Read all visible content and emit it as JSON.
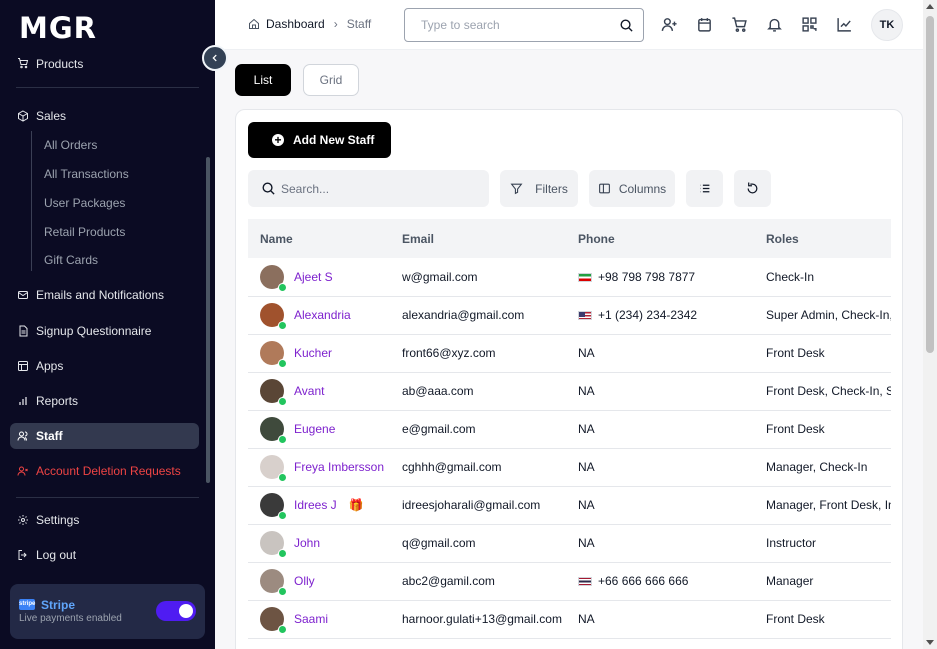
{
  "app": {
    "logo": "MGR"
  },
  "sidebar": {
    "items": [
      {
        "label": "Products",
        "icon": "cart-icon"
      },
      {
        "label": "Sales",
        "icon": "box-icon"
      },
      {
        "label": "Emails and Notifications",
        "icon": "mail-icon"
      },
      {
        "label": "Signup Questionnaire",
        "icon": "document-icon"
      },
      {
        "label": "Apps",
        "icon": "apps-icon"
      },
      {
        "label": "Reports",
        "icon": "bar-chart-icon"
      },
      {
        "label": "Staff",
        "icon": "users-icon"
      },
      {
        "label": "Account Deletion Requests",
        "icon": "user-x-icon"
      },
      {
        "label": "Settings",
        "icon": "gear-icon"
      },
      {
        "label": "Log out",
        "icon": "logout-icon"
      }
    ],
    "sales_sub": [
      "All Orders",
      "All Transactions",
      "User Packages",
      "Retail Products",
      "Gift Cards"
    ],
    "stripe": {
      "title": "Stripe",
      "subtitle": "Live payments enabled",
      "logo_text": "stripe",
      "enabled": true
    }
  },
  "header": {
    "breadcrumb": {
      "home": "Dashboard",
      "current": "Staff"
    },
    "search_placeholder": "Type to search",
    "avatar_initials": "TK"
  },
  "view_tabs": {
    "list": "List",
    "grid": "Grid"
  },
  "toolbar": {
    "add_label": "Add New Staff",
    "search_placeholder": "Search...",
    "filters_label": "Filters",
    "columns_label": "Columns"
  },
  "table": {
    "headers": [
      "Name",
      "Email",
      "Phone",
      "Roles"
    ],
    "rows": [
      {
        "name": "Ajeet S",
        "email": "w@gmail.com",
        "flag": "ir",
        "phone": "+98 798 798 7877",
        "roles": "Check-In",
        "avatar_color": "#8b6f5e"
      },
      {
        "name": "Alexandria",
        "email": "alexandria@gmail.com",
        "flag": "us",
        "phone": "+1 (234) 234-2342",
        "roles": "Super Admin, Check-In, Instructor",
        "avatar_color": "#a0522d"
      },
      {
        "name": "Kucher",
        "email": "front66@xyz.com",
        "flag": "",
        "phone": "NA",
        "roles": "Front Desk",
        "avatar_color": "#b07a5a"
      },
      {
        "name": "Avant",
        "email": "ab@aaa.com",
        "flag": "",
        "phone": "NA",
        "roles": "Front Desk, Check-In, Super Admin",
        "avatar_color": "#5a4636"
      },
      {
        "name": "Eugene",
        "email": "e@gmail.com",
        "flag": "",
        "phone": "NA",
        "roles": "Front Desk",
        "avatar_color": "#3f4a3c"
      },
      {
        "name": "Freya Imbersson",
        "email": "cghhh@gmail.com",
        "flag": "",
        "phone": "NA",
        "roles": "Manager, Check-In",
        "avatar_color": "#d8d0cc"
      },
      {
        "name": "Idrees J",
        "email": "idreesjoharali@gmail.com",
        "flag": "",
        "phone": "NA",
        "roles": "Manager, Front Desk, Instructor",
        "avatar_color": "#3a3a3a",
        "gift": true
      },
      {
        "name": "John",
        "email": "q@gmail.com",
        "flag": "",
        "phone": "NA",
        "roles": "Instructor",
        "avatar_color": "#c9c4c0"
      },
      {
        "name": "Olly",
        "email": "abc2@gamil.com",
        "flag": "th",
        "phone": "+66 666 666 666",
        "roles": "Manager",
        "avatar_color": "#9c8b80"
      },
      {
        "name": "Saami",
        "email": "harnoor.gulati+13@gmail.com",
        "flag": "",
        "phone": "NA",
        "roles": "Front Desk",
        "avatar_color": "#6d5443"
      }
    ]
  }
}
